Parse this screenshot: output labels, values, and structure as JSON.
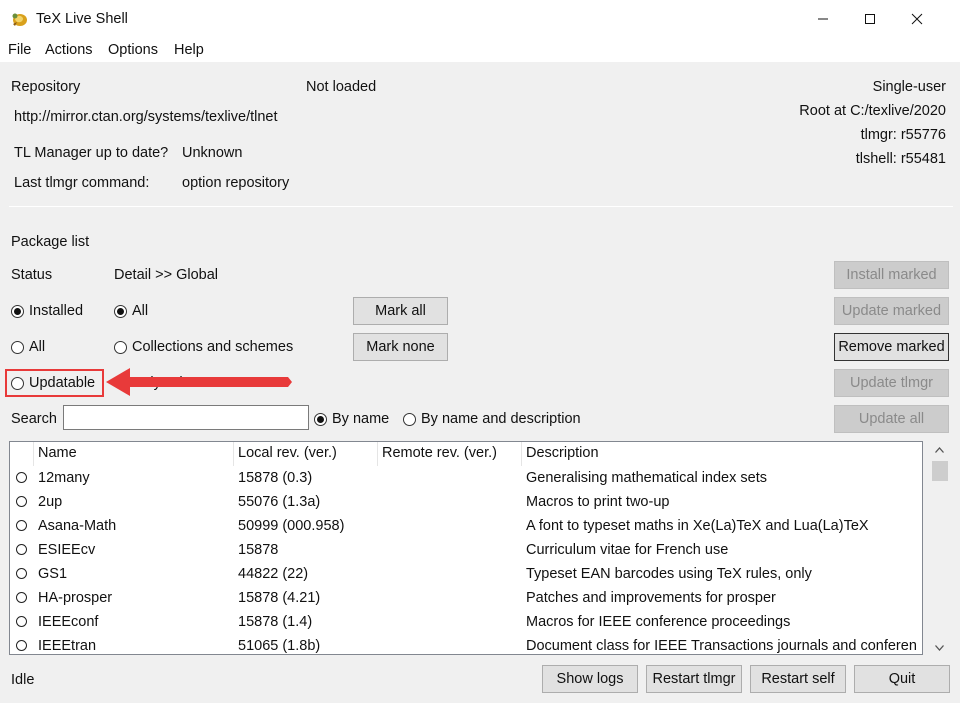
{
  "window": {
    "title": "TeX Live Shell"
  },
  "menu": [
    "File",
    "Actions",
    "Options",
    "Help"
  ],
  "info": {
    "repository_label": "Repository",
    "repository_status": "Not loaded",
    "repository_url": "http://mirror.ctan.org/systems/texlive/tlnet",
    "tlmgr_uptodate_label": "TL Manager up to date?",
    "tlmgr_uptodate_value": "Unknown",
    "last_cmd_label": "Last tlmgr command:",
    "last_cmd_value": "option repository",
    "mode": "Single-user",
    "root": "Root at C:/texlive/2020",
    "tlmgr_rev": "tlmgr: r55776",
    "tlshell_rev": "tlshell: r55481"
  },
  "packages": {
    "section_label": "Package list",
    "status_label": "Status",
    "detail_label": "Detail >> Global",
    "status_options": {
      "installed": "Installed",
      "all": "All",
      "updatable": "Updatable"
    },
    "detail_options": {
      "all": "All",
      "collections": "Collections and schemes",
      "only_schemes": "Only schemes"
    },
    "mark_all": "Mark all",
    "mark_none": "Mark none",
    "install_marked": "Install marked",
    "update_marked": "Update marked",
    "remove_marked": "Remove marked",
    "update_tlmgr": "Update tlmgr",
    "update_all": "Update all",
    "search_label": "Search",
    "search_value": "",
    "search_by_name": "By name",
    "search_by_desc": "By name and description",
    "columns": {
      "name": "Name",
      "local": "Local rev. (ver.)",
      "remote": "Remote rev. (ver.)",
      "desc": "Description"
    },
    "rows": [
      {
        "name": "12many",
        "local": "15878 (0.3)",
        "remote": "",
        "desc": "Generalising mathematical index sets"
      },
      {
        "name": "2up",
        "local": "55076 (1.3a)",
        "remote": "",
        "desc": "Macros to print two-up"
      },
      {
        "name": "Asana-Math",
        "local": "50999 (000.958)",
        "remote": "",
        "desc": "A font to typeset maths in Xe(La)TeX and Lua(La)TeX"
      },
      {
        "name": "ESIEEcv",
        "local": "15878",
        "remote": "",
        "desc": "Curriculum vitae for French use"
      },
      {
        "name": "GS1",
        "local": "44822 (22)",
        "remote": "",
        "desc": "Typeset EAN barcodes using TeX rules, only"
      },
      {
        "name": "HA-prosper",
        "local": "15878 (4.21)",
        "remote": "",
        "desc": "Patches and improvements for prosper"
      },
      {
        "name": "IEEEconf",
        "local": "15878 (1.4)",
        "remote": "",
        "desc": "Macros for IEEE conference proceedings"
      },
      {
        "name": "IEEEtran",
        "local": "51065 (1.8b)",
        "remote": "",
        "desc": "Document class for IEEE Transactions journals and conferen"
      }
    ]
  },
  "statusbar": {
    "status": "Idle",
    "show_logs": "Show logs",
    "restart_tlmgr": "Restart tlmgr",
    "restart_self": "Restart self",
    "quit": "Quit"
  },
  "colors": {
    "highlight": "#e83a3a",
    "window_bg": "#f0f0f0"
  }
}
